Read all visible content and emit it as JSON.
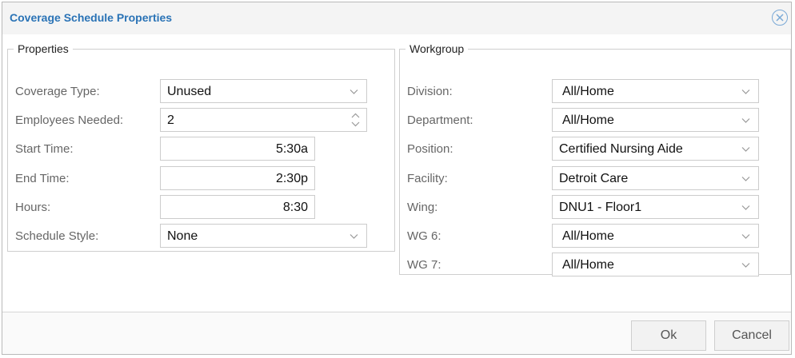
{
  "dialog": {
    "title": "Coverage Schedule Properties",
    "close_icon": "close-circle-icon",
    "accent_color": "#2a73b6"
  },
  "properties": {
    "legend": "Properties",
    "coverage_type": {
      "label": "Coverage Type:",
      "value": "Unused"
    },
    "employees_needed": {
      "label": "Employees Needed:",
      "value": "2"
    },
    "start_time": {
      "label": "Start Time:",
      "value": "5:30a"
    },
    "end_time": {
      "label": "End Time:",
      "value": "2:30p"
    },
    "hours": {
      "label": "Hours:",
      "value": "8:30"
    },
    "schedule_style": {
      "label": "Schedule Style:",
      "value": "None"
    }
  },
  "workgroup": {
    "legend": "Workgroup",
    "division": {
      "label": "Division:",
      "value": "All/Home"
    },
    "department": {
      "label": "Department:",
      "value": "All/Home"
    },
    "position": {
      "label": "Position:",
      "value": "Certified Nursing Aide"
    },
    "facility": {
      "label": "Facility:",
      "value": "Detroit Care"
    },
    "wing": {
      "label": "Wing:",
      "value": "DNU1 - Floor1"
    },
    "wg6": {
      "label": "WG 6:",
      "value": "All/Home"
    },
    "wg7": {
      "label": "WG 7:",
      "value": "All/Home"
    }
  },
  "footer": {
    "ok_label": "Ok",
    "cancel_label": "Cancel"
  }
}
